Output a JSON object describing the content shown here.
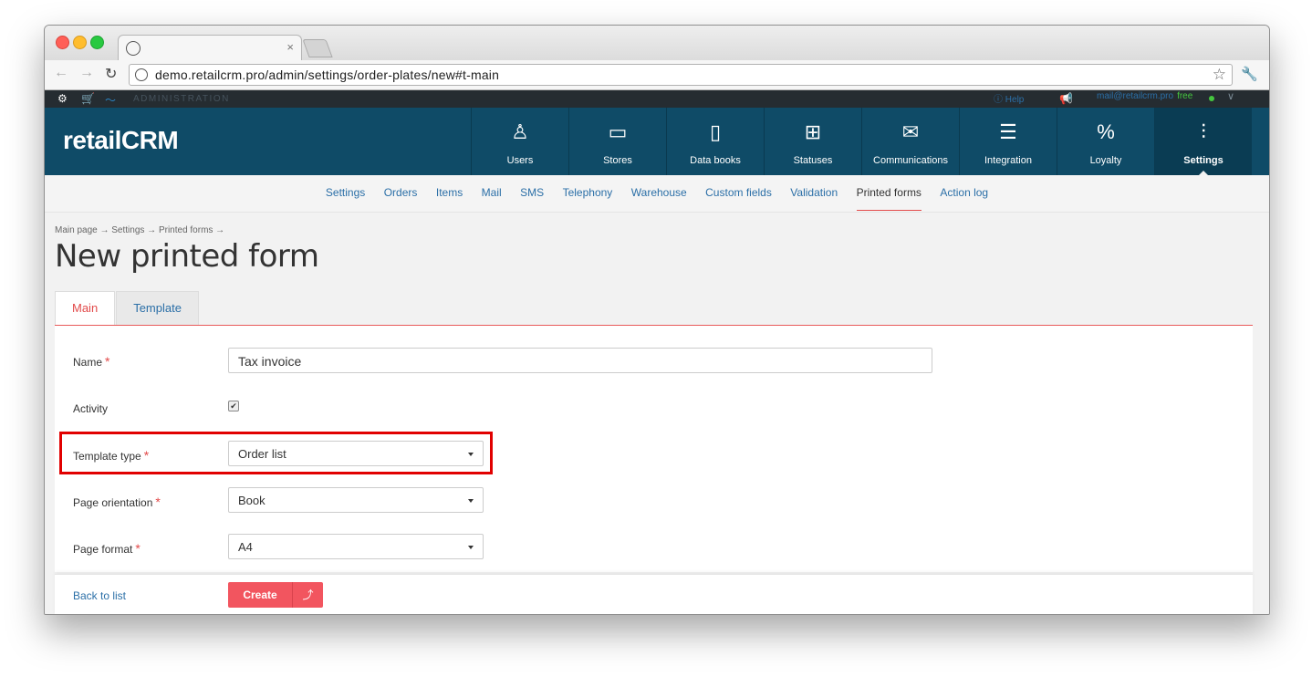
{
  "browser": {
    "url": "demo.retailcrm.pro/admin/settings/order-plates/new#t-main",
    "tab_close": "×"
  },
  "topbar": {
    "section_label": "ADMINISTRATION",
    "help": "Help",
    "email": "mail@retailcrm.pro",
    "plan": "free"
  },
  "header": {
    "logo": "retailCRM",
    "nav": [
      {
        "label": "Users",
        "icon": "user-icon",
        "glyph": "♙"
      },
      {
        "label": "Stores",
        "icon": "store-window-icon",
        "glyph": "▭"
      },
      {
        "label": "Data books",
        "icon": "book-icon",
        "glyph": "▯"
      },
      {
        "label": "Statuses",
        "icon": "grid-icon",
        "glyph": "⊞"
      },
      {
        "label": "Communications",
        "icon": "envelope-icon",
        "glyph": "✉"
      },
      {
        "label": "Integration",
        "icon": "lines-icon",
        "glyph": "☰"
      },
      {
        "label": "Loyalty",
        "icon": "percent-tag-icon",
        "glyph": "%"
      },
      {
        "label": "Settings",
        "icon": "sliders-icon",
        "glyph": "⫶"
      }
    ]
  },
  "subnav": [
    "Settings",
    "Orders",
    "Items",
    "Mail",
    "SMS",
    "Telephony",
    "Warehouse",
    "Custom fields",
    "Validation",
    "Printed forms",
    "Action log"
  ],
  "breadcrumb": "Main page → Settings → Printed forms →",
  "page_title": "New printed form",
  "tabs": [
    "Main",
    "Template"
  ],
  "form": {
    "name_label": "Name",
    "name_value": "Tax invoice",
    "activity_label": "Activity",
    "template_type_label": "Template type",
    "template_type_value": "Order list",
    "orientation_label": "Page orientation",
    "orientation_value": "Book",
    "format_label": "Page format",
    "format_value": "A4",
    "required_mark": "*"
  },
  "footer": {
    "back": "Back to list",
    "create": "Create",
    "create_arrow": "⤴"
  },
  "colors": {
    "header_bg": "#0f4b67",
    "accent_red": "#e24a4a",
    "button_red": "#f2555f",
    "link_blue": "#2b6fa7"
  }
}
